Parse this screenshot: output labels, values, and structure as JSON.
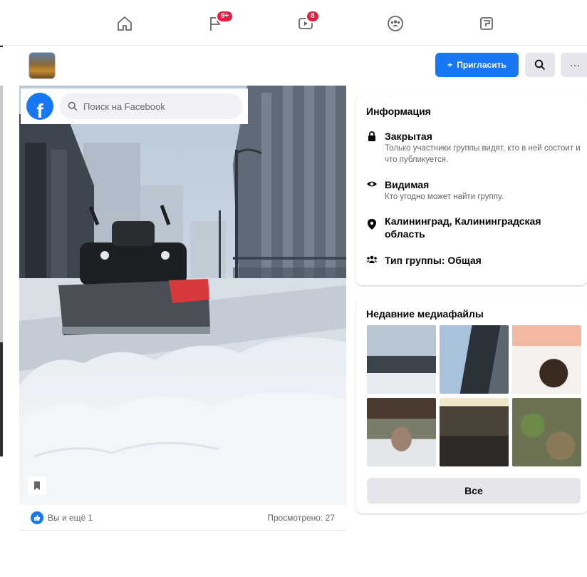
{
  "nav": {
    "items": [
      {
        "icon": "home-icon"
      },
      {
        "icon": "flag-icon",
        "badge": "9+"
      },
      {
        "icon": "video-icon",
        "badge": "8"
      },
      {
        "icon": "groups-icon"
      },
      {
        "icon": "gaming-icon"
      }
    ]
  },
  "group_header": {
    "invite_label": "Пригласить",
    "search_icon": "search-icon",
    "more_icon": "more-icon"
  },
  "photo_overlay": {
    "search_placeholder": "Поиск на Facebook"
  },
  "post_footer": {
    "reactions": "Вы и ещё 1",
    "views": "Просмотрено: 27"
  },
  "info": {
    "title": "Информация",
    "privacy_title": "Закрытая",
    "privacy_desc": "Только участники группы видят, кто в ней состоит и что публикуется.",
    "visibility_title": "Видимая",
    "visibility_desc": "Кто угодно может найти группу.",
    "location": "Калининград, Калининградская область",
    "group_type": "Тип группы: Общая"
  },
  "media": {
    "title": "Недавние медиафайлы",
    "all_label": "Все"
  },
  "colors": {
    "accent": "#1877f2",
    "badge": "#e41e3f",
    "background": "#f0f2f5"
  }
}
